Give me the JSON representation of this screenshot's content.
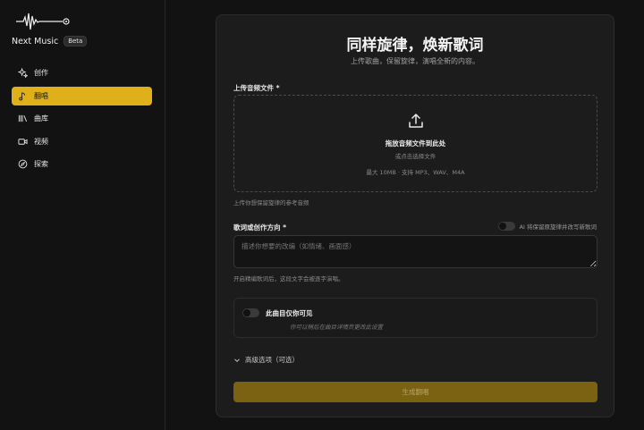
{
  "app": {
    "name": "Next Music",
    "badge": "Beta"
  },
  "sidebar": {
    "items": [
      {
        "label": "创作",
        "icon": "sparkle-icon",
        "active": false
      },
      {
        "label": "翻唱",
        "icon": "music-note-icon",
        "active": true
      },
      {
        "label": "曲库",
        "icon": "library-icon",
        "active": false
      },
      {
        "label": "视频",
        "icon": "video-icon",
        "active": false
      },
      {
        "label": "探索",
        "icon": "compass-icon",
        "active": false
      }
    ],
    "accent": "#e0b01a"
  },
  "main": {
    "title": "同样旋律，焕新歌词",
    "subtitle": "上传歌曲，保留旋律，演唱全新的内容。",
    "upload": {
      "label": "上传音频文件 *",
      "drop_title": "拖放音频文件到此处",
      "drop_sub": "或点击选择文件",
      "limit": "最大 10MB · 支持 MP3、WAV、M4A",
      "hint": "上传你想保留旋律的参考音频"
    },
    "lyrics": {
      "label": "歌词或创作方向 *",
      "ai_toggle_label": "AI 将保留原旋律并改写新歌词",
      "placeholder": "描述你想要的改编（如情绪、画面感）",
      "hint": "开启精编歌词后，这段文字会被逐字演唱。"
    },
    "privacy": {
      "title": "此曲目仅你可见",
      "sub": "你可以稍后在曲目详情页更改此设置"
    },
    "advanced_label": "高级选项（可选）",
    "generate_label": "生成翻唱"
  }
}
